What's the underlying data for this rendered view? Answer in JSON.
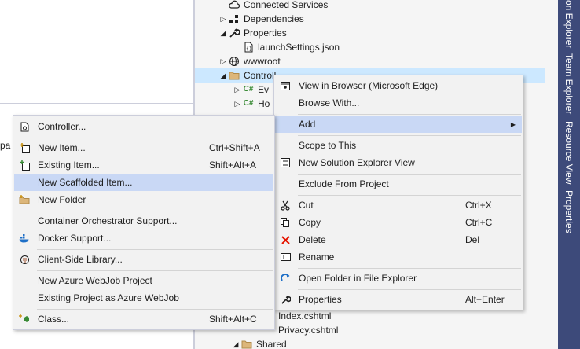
{
  "editor": {
    "fragment": "pa"
  },
  "tree": {
    "items": [
      {
        "label": "Connected Services",
        "icon": "cloud-icon",
        "expander": ""
      },
      {
        "label": "Dependencies",
        "icon": "dependencies-icon",
        "expander": "▷"
      },
      {
        "label": "Properties",
        "icon": "wrench-icon",
        "expander": "◢"
      },
      {
        "label": "launchSettings.json",
        "icon": "json-file-icon",
        "expander": ""
      },
      {
        "label": "wwwroot",
        "icon": "globe-icon",
        "expander": "▷"
      },
      {
        "label": "Controll",
        "icon": "folder-icon",
        "expander": "◢"
      },
      {
        "label": "Ev",
        "icon": "csharp-file-icon",
        "expander": "▷"
      },
      {
        "label": "Ho",
        "icon": "csharp-file-icon",
        "expander": "▷"
      },
      {
        "label": "Index.cshtml",
        "icon": "",
        "expander": ""
      },
      {
        "label": "Privacy.cshtml",
        "icon": "",
        "expander": ""
      },
      {
        "label": "Shared",
        "icon": "folder-icon",
        "expander": "◢"
      }
    ]
  },
  "side_tabs": [
    "on Explorer",
    "Team Explorer",
    "Resource View",
    "Properties"
  ],
  "context_menu": {
    "items": [
      {
        "label": "View in Browser (Microsoft Edge)",
        "shortcut": "",
        "icon": "view-in-browser-icon"
      },
      {
        "label": "Browse With...",
        "shortcut": "",
        "icon": ""
      },
      {
        "label": "Add",
        "shortcut": "",
        "icon": "",
        "submenu_arrow": "▶"
      },
      {
        "label": "Scope to This",
        "shortcut": "",
        "icon": ""
      },
      {
        "label": "New Solution Explorer View",
        "shortcut": "",
        "icon": "new-solution-view-icon"
      },
      {
        "label": "Exclude From Project",
        "shortcut": "",
        "icon": ""
      },
      {
        "label": "Cut",
        "shortcut": "Ctrl+X",
        "icon": "scissors-icon"
      },
      {
        "label": "Copy",
        "shortcut": "Ctrl+C",
        "icon": "copy-icon"
      },
      {
        "label": "Delete",
        "shortcut": "Del",
        "icon": "delete-x-icon"
      },
      {
        "label": "Rename",
        "shortcut": "",
        "icon": "rename-icon"
      },
      {
        "label": "Open Folder in File Explorer",
        "shortcut": "",
        "icon": "refresh-arrow-icon"
      },
      {
        "label": "Properties",
        "shortcut": "Alt+Enter",
        "icon": "wrench-icon"
      }
    ]
  },
  "add_submenu": {
    "items": [
      {
        "label": "Controller...",
        "shortcut": "",
        "icon": "controller-icon"
      },
      {
        "label": "New Item...",
        "shortcut": "Ctrl+Shift+A",
        "icon": "new-item-icon"
      },
      {
        "label": "Existing Item...",
        "shortcut": "Shift+Alt+A",
        "icon": "existing-item-icon"
      },
      {
        "label": "New Scaffolded Item...",
        "shortcut": "",
        "icon": ""
      },
      {
        "label": "New Folder",
        "shortcut": "",
        "icon": "new-folder-icon"
      },
      {
        "label": "Container Orchestrator Support...",
        "shortcut": "",
        "icon": ""
      },
      {
        "label": "Docker Support...",
        "shortcut": "",
        "icon": "docker-icon"
      },
      {
        "label": "Client-Side Library...",
        "shortcut": "",
        "icon": "client-library-icon"
      },
      {
        "label": "New Azure WebJob Project",
        "shortcut": "",
        "icon": ""
      },
      {
        "label": "Existing Project as Azure WebJob",
        "shortcut": "",
        "icon": ""
      },
      {
        "label": "Class...",
        "shortcut": "Shift+Alt+C",
        "icon": "class-icon"
      }
    ]
  },
  "colors": {
    "menu_highlight": "#c9d8f5",
    "tree_selected": "#cce8ff",
    "side_tab_bg": "#3d4a7a",
    "csharp_green": "#388a34",
    "folder_yellow": "#dcb67a",
    "delete_red": "#e51400",
    "accent_blue": "#1e6fc7"
  }
}
